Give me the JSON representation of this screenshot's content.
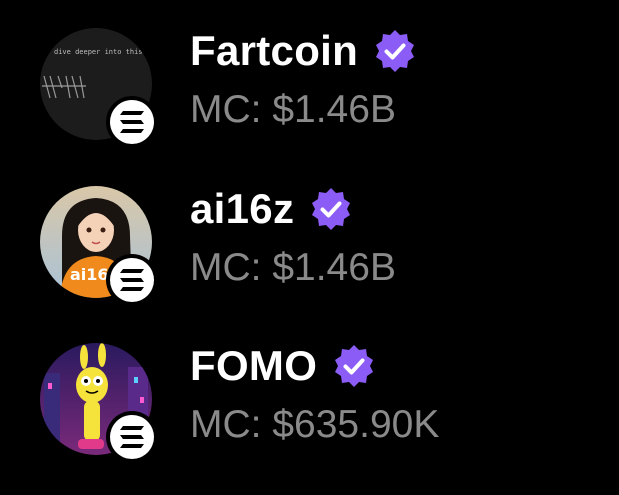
{
  "tokens": [
    {
      "name": "Fartcoin",
      "mc_label": "MC:",
      "mc_value": "$1.46B",
      "verified": true,
      "avatar_icon": "fartcoin-avatar-icon",
      "avatar_text": "dive deeper into this",
      "chain_icon": "solana-icon"
    },
    {
      "name": "ai16z",
      "mc_label": "MC:",
      "mc_value": "$1.46B",
      "verified": true,
      "avatar_icon": "ai16z-avatar-icon",
      "avatar_text": "ai16",
      "chain_icon": "solana-icon"
    },
    {
      "name": "FOMO",
      "mc_label": "MC:",
      "mc_value": "$635.90K",
      "verified": true,
      "avatar_icon": "fomo-avatar-icon",
      "chain_icon": "solana-icon"
    }
  ],
  "colors": {
    "background": "#000000",
    "name_text": "#ffffff",
    "mc_text": "#8a8a8a",
    "verified_badge": "#8b5cf6"
  }
}
